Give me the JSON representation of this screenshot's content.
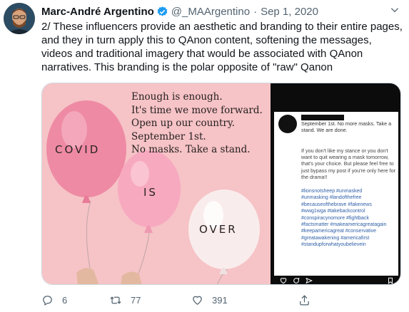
{
  "tweet": {
    "display_name": "Marc-André Argentino",
    "handle": "@_MAArgentino",
    "separator": "·",
    "date": "Sep 1, 2020",
    "text": "2/ These influencers provide an aesthetic and branding to their entire pages, and they in turn apply this to QAnon content, softening the messages, videos and traditional imagery that would be associated with QAnon narratives. This branding is the polar opposite of \"raw\" Qanon",
    "verified_icon": "verified-badge-icon",
    "more_icon": "chevron-down-icon",
    "accent_color": "#1d9bf0"
  },
  "media": {
    "quote_lines": [
      "Enough is enough.",
      "It's time we move forward.",
      "Open up our country.",
      "September 1st.",
      "No masks. Take a stand."
    ],
    "balloon_words": [
      "COVID",
      "IS",
      "OVER"
    ],
    "background_color": "#f6c3c6",
    "instagram": {
      "caption": "September 1st. No more masks. Take a stand. We are done.",
      "body": "If you don't like my stance or you don't want to quit wearing a mask tomorrow, that's your choice. But please feel free to just bypass my post if you're only here for the drama!!",
      "hashtags": [
        "#lionsnotsheep #unmasked",
        "#unmasking #landofthefree",
        "#becauseofthebrave #fakenews",
        "#wwg1wga #takebackcontrol",
        "#conspiracynomore #fightback",
        "#factsmatter #makeamericagreatagain",
        "#keepamericagreat #conservative",
        "#greatawakening #americafirst",
        "#standupforwhatyoubelievein"
      ],
      "hashtag_color": "#2f5fa7"
    }
  },
  "actions": {
    "reply_count": "6",
    "retweet_count": "77",
    "like_count": "391",
    "icons": [
      "reply-icon",
      "retweet-icon",
      "like-icon",
      "share-icon"
    ]
  }
}
